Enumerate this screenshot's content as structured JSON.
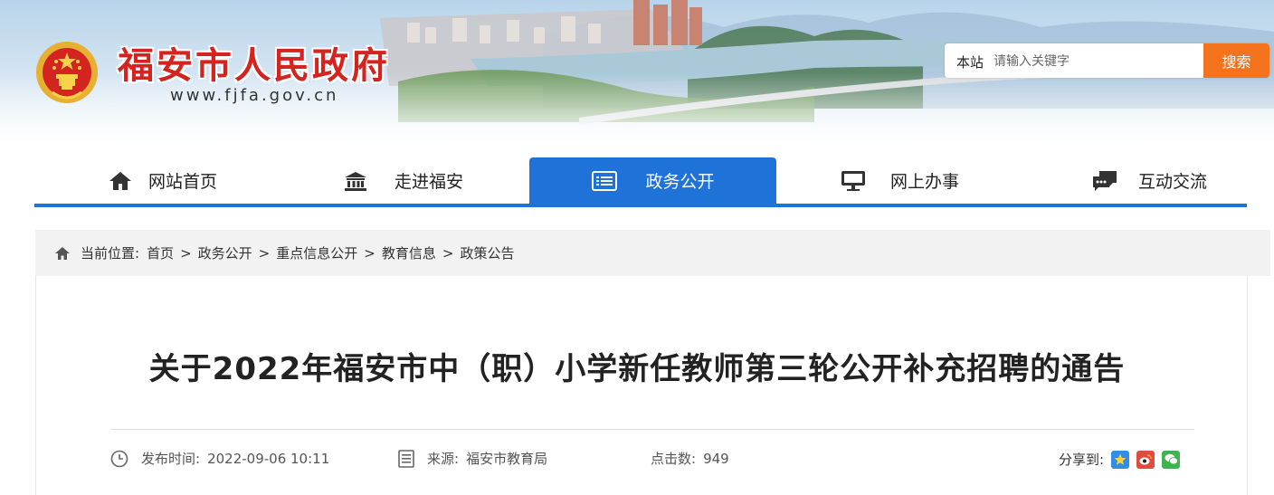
{
  "header": {
    "site_name": "福安市人民政府",
    "site_url": "www.fjfa.gov.cn",
    "emblem_icon": "national-emblem-icon"
  },
  "search": {
    "scope": "本站",
    "placeholder": "请输入关键字",
    "button": "搜索"
  },
  "nav": {
    "items": [
      {
        "label": "网站首页",
        "icon": "home-icon"
      },
      {
        "label": "走进福安",
        "icon": "government-building-icon"
      },
      {
        "label": "政务公开",
        "icon": "document-list-icon",
        "active": true
      },
      {
        "label": "网上办事",
        "icon": "monitor-icon"
      },
      {
        "label": "互动交流",
        "icon": "chat-bubbles-icon"
      }
    ]
  },
  "breadcrumb": {
    "prefix": "当前位置:",
    "items": [
      "首页",
      "政务公开",
      "重点信息公开",
      "教育信息",
      "政策公告"
    ],
    "separator": ">"
  },
  "article": {
    "title": "关于2022年福安市中（职）小学新任教师第三轮公开补充招聘的通告",
    "publish_label": "发布时间:",
    "publish_time": "2022-09-06 10:11",
    "source_label": "来源:",
    "source": "福安市教育局",
    "clicks_label": "点击数:",
    "clicks": "949",
    "share_label": "分享到:"
  },
  "colors": {
    "brand_red": "#d42420",
    "nav_blue": "#1f73d8",
    "search_orange": "#f5731c"
  }
}
